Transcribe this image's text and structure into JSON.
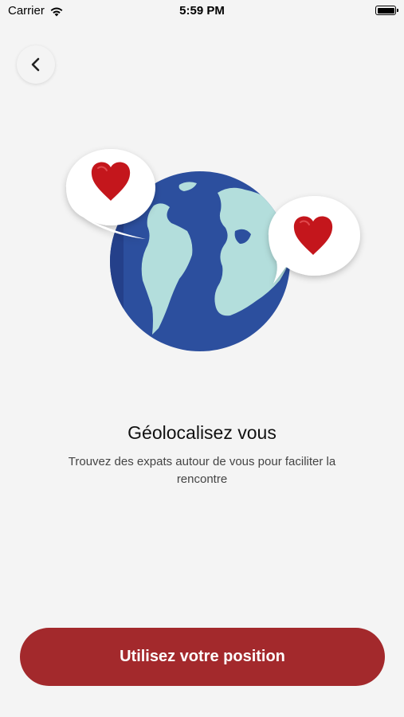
{
  "status_bar": {
    "carrier": "Carrier",
    "time": "5:59 PM"
  },
  "onboarding": {
    "title": "Géolocalisez vous",
    "subtitle": "Trouvez des expats autour de vous pour faciliter la rencontre",
    "cta_label": "Utilisez votre position"
  },
  "colors": {
    "accent": "#a3292c",
    "globe_ocean": "#2c4f9e",
    "globe_land": "#b3dedc",
    "heart": "#c4161c"
  }
}
